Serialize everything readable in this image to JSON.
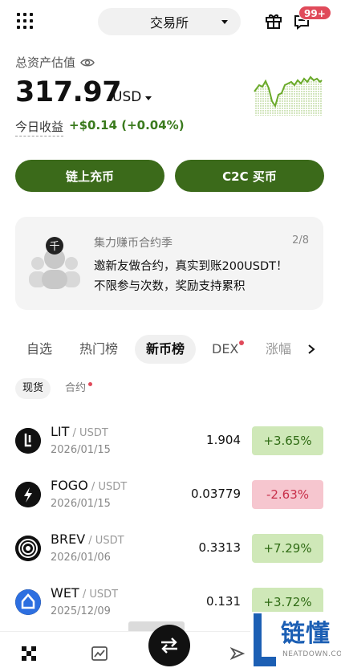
{
  "header": {
    "exchange_label": "交易所",
    "notification_badge": "99+"
  },
  "account": {
    "total_label": "总资产估值",
    "balance": "317.97",
    "currency": "USD",
    "today_label": "今日收益",
    "today_value": "+$0.14 (+0.04%)"
  },
  "actions": {
    "deposit_label": "链上充币",
    "c2c_label": "C2C 买币"
  },
  "promo": {
    "title": "集力赚币合约季",
    "page": "2/8",
    "line1": "邀新友做合约，真实到账200USDT！",
    "line2": "不限参与次数，奖励支持累积"
  },
  "tabs": [
    "自选",
    "热门榜",
    "新币榜",
    "DEX",
    "涨幅"
  ],
  "active_tab": "新币榜",
  "subtabs": [
    "现货",
    "合约"
  ],
  "coins": [
    {
      "symbol": "LIT",
      "pair": " / USDT",
      "date": "2026/01/15",
      "price": "1.904",
      "change": "+3.65%",
      "direction": "up",
      "icon": "lit-icon"
    },
    {
      "symbol": "FOGO",
      "pair": " / USDT",
      "date": "2026/01/15",
      "price": "0.03779",
      "change": "-2.63%",
      "direction": "down",
      "icon": "fogo-icon"
    },
    {
      "symbol": "BREV",
      "pair": " / USDT",
      "date": "2026/01/06",
      "price": "0.3313",
      "change": "+7.29%",
      "direction": "up",
      "icon": "brev-icon"
    },
    {
      "symbol": "WET",
      "pair": " / USDT",
      "date": "2025/12/09",
      "price": "0.131",
      "change": "+3.72%",
      "direction": "up",
      "icon": "wet-icon"
    }
  ],
  "watermark": {
    "text": "链懂",
    "sub": "NEATDOWN.COM"
  },
  "colors": {
    "accent_green": "#3b6a1a",
    "up_bg": "#cfe8b8",
    "down_bg": "#f6c6cf",
    "badge_red": "#e04a5a"
  }
}
